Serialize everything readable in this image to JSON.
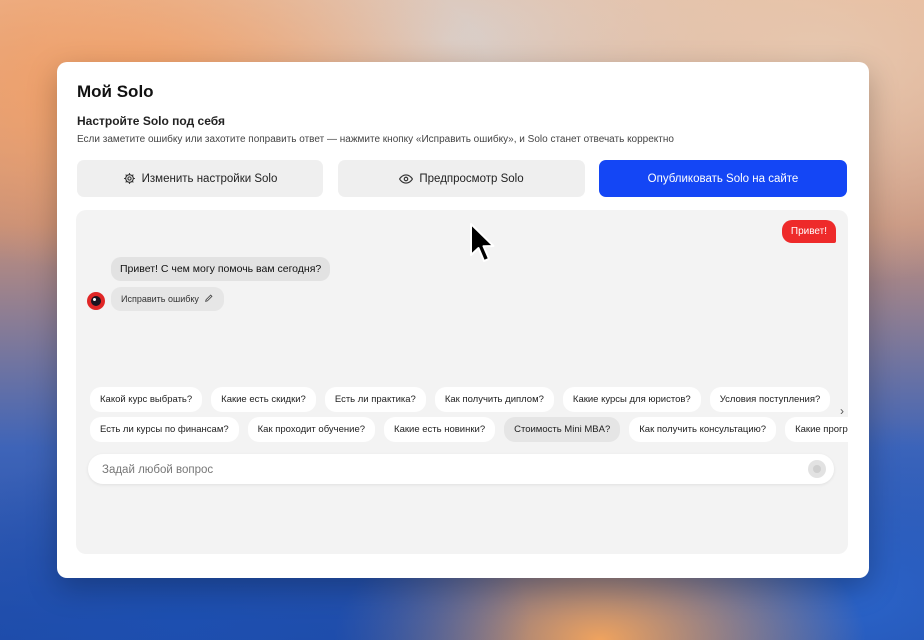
{
  "app": {
    "title": "Мой Solo",
    "subtitle": "Настройте Solo под себя",
    "description": "Если заметите ошибку или захотите поправить ответ — нажмите кнопку «Исправить ошибку», и Solo станет отвечать корректно"
  },
  "toolbar": {
    "settings_label": "Изменить настройки Solo",
    "settings_icon": "gear-icon",
    "preview_label": "Предпросмотр Solo",
    "preview_icon": "eye-icon",
    "publish_label": "Опубликовать Solo на сайте"
  },
  "chat": {
    "user_message": "Привет!",
    "bot_message": "Привет! С чем могу помочь вам сегодня?",
    "fix_label": "Исправить ошибку",
    "fix_icon": "pencil-icon",
    "chips_row1": [
      "Какой курс выбрать?",
      "Какие есть скидки?",
      "Есть ли практика?",
      "Как получить диплом?",
      "Какие курсы для юристов?",
      "Условия поступления?"
    ],
    "chips_row2": [
      "Есть ли курсы по финансам?",
      "Как проходит обучение?",
      "Какие есть новинки?",
      "Стоимость Mini MBA?",
      "Как получить консультацию?",
      "Какие програ"
    ],
    "active_chip": "Стоимость Mini MBA?",
    "input_placeholder": "Задай любой вопрос",
    "input_value": ""
  },
  "colors": {
    "accent": "#1446f5",
    "user_bubble": "#ee2a2a",
    "chat_background": "#f3f3f3"
  }
}
